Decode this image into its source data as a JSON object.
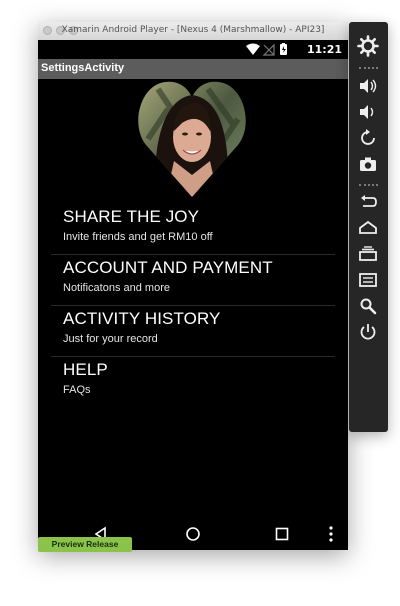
{
  "window": {
    "title": "Xamarin Android Player - [Nexus 4 (Marshmallow) - API23]"
  },
  "statusbar": {
    "time": "11:21"
  },
  "actionbar": {
    "title": "SettingsActivity"
  },
  "menu": {
    "items": [
      {
        "title": "SHARE THE JOY",
        "subtitle": "Invite friends and get RM10 off"
      },
      {
        "title": "ACCOUNT AND PAYMENT",
        "subtitle": "Notificatons and more"
      },
      {
        "title": "ACTIVITY HISTORY",
        "subtitle": "Just for your record"
      },
      {
        "title": "HELP",
        "subtitle": "FAQs"
      }
    ]
  },
  "badge": {
    "label": "Preview Release",
    "color": "#8bc34a"
  },
  "icons": {
    "status": [
      "wifi-icon",
      "no-signal-icon",
      "battery-charging-icon"
    ],
    "navbar": [
      "back-icon",
      "home-icon",
      "recents-icon",
      "overflow-menu-icon"
    ],
    "sidepanel": [
      "settings-gear-icon",
      "volume-up-icon",
      "volume-down-icon",
      "rotate-icon",
      "camera-icon",
      "back-icon",
      "home-icon",
      "recents-icon",
      "menu-icon",
      "search-icon",
      "power-icon"
    ]
  },
  "colors": {
    "screen_bg": "#000000",
    "actionbar_bg": "#5c5c5c",
    "panel_bg": "#262626"
  }
}
